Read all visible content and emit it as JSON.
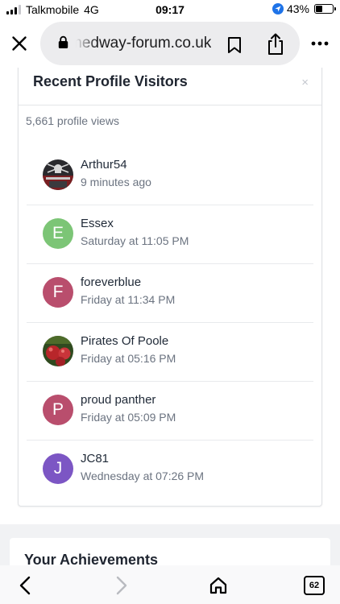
{
  "status_bar": {
    "carrier": "Talkmobile",
    "network": "4G",
    "time": "09:17",
    "battery": "43%",
    "battery_level": 0.43
  },
  "browser": {
    "url": "medway-forum.co.uk",
    "icons": [
      "close-icon",
      "lock-icon",
      "bookmark-icon",
      "share-icon",
      "more-icon"
    ]
  },
  "visitors_panel": {
    "title": "Recent Profile Visitors",
    "close_glyph": "×",
    "views": "5,661 profile views",
    "visitors": [
      {
        "name": "Arthur54",
        "time": "9 minutes ago",
        "avatar_type": "image",
        "avatar_image": "flag",
        "avatar_letter": ""
      },
      {
        "name": "Essex",
        "time": "Saturday at 11:05 PM",
        "avatar_type": "letter",
        "avatar_letter": "E",
        "avatar_color": "#7cc576"
      },
      {
        "name": "foreverblue",
        "time": "Friday at 11:34 PM",
        "avatar_type": "letter",
        "avatar_letter": "F",
        "avatar_color": "#b94e6d"
      },
      {
        "name": "Pirates Of Poole",
        "time": "Friday at 05:16 PM",
        "avatar_type": "image",
        "avatar_image": "apples",
        "avatar_letter": ""
      },
      {
        "name": "proud panther",
        "time": "Friday at 05:09 PM",
        "avatar_type": "letter",
        "avatar_letter": "P",
        "avatar_color": "#b94e6d"
      },
      {
        "name": "JC81",
        "time": "Wednesday at 07:26 PM",
        "avatar_type": "letter",
        "avatar_letter": "J",
        "avatar_color": "#7c56c4"
      }
    ]
  },
  "achievements": {
    "title": "Your Achievements"
  },
  "toolbar": {
    "tab_count": "62",
    "icons": [
      "back-icon",
      "forward-icon",
      "home-icon",
      "tabs-icon"
    ]
  }
}
